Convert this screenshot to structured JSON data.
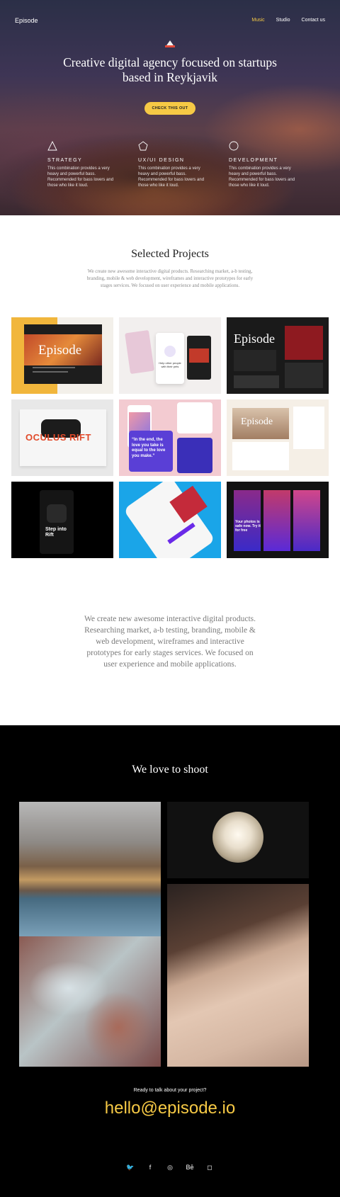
{
  "nav": {
    "logo": "Episode",
    "items": [
      {
        "label": "Music",
        "active": true
      },
      {
        "label": "Studio",
        "active": false
      },
      {
        "label": "Contact us",
        "active": false
      }
    ]
  },
  "hero": {
    "title": "Creative digital agency focused on startups based in Reykjavik",
    "cta": "CHECK THIS OUT",
    "features": [
      {
        "icon": "triangle-icon",
        "title": "STRATEGY",
        "desc": "This combination provides a very heavy and powerful bass. Recommended for bass lovers and those who like it loud."
      },
      {
        "icon": "pentagon-icon",
        "title": "UX/UI DESIGN",
        "desc": "This combination provides a very heavy and powerful bass. Recommended for bass lovers and those who like it loud."
      },
      {
        "icon": "circle-icon",
        "title": "DEVELOPMENT",
        "desc": "This combination provides a very heavy and powerful bass. Recommended for bass lovers and those who like it loud."
      }
    ]
  },
  "projects": {
    "title": "Selected Projects",
    "lead": "We create new awesome interactive digital products. Researching market, a-b testing, branding, mobile & web development, wireframes and interactive prototypes for early stages services. We focused on user experience and mobile applications.",
    "tiles": [
      {
        "name": "episode-web",
        "text": "Episode"
      },
      {
        "name": "mobile-app-white",
        "text": "Help other people with their pets"
      },
      {
        "name": "episode-dark",
        "text": "Episode"
      },
      {
        "name": "oculus-rift",
        "text": "OCULUS RIFT"
      },
      {
        "name": "quote-app",
        "text": "“In the end, the love you take is equal to the love you make.”"
      },
      {
        "name": "episode-sand",
        "text": "Episode"
      },
      {
        "name": "step-into-rift",
        "text": "Step into Rift"
      },
      {
        "name": "sneaker-app",
        "text": ""
      },
      {
        "name": "photos-app",
        "text": "Your photos is safe now. Try it for free"
      }
    ],
    "body": "We create new awesome interactive digital products. Researching market, a-b testing, branding, mobile & web development, wireframes and interactive prototypes for early stages services. We focused on user experience and mobile applications."
  },
  "shoot": {
    "title": "We love to shoot",
    "ready": "Ready to talk about your project?",
    "email": "hello@episode.io",
    "socials": [
      "twitter-icon",
      "facebook-icon",
      "dribbble-icon",
      "behance-icon",
      "instagram-icon"
    ],
    "social_glyphs": [
      "🐦",
      "f",
      "◎",
      "Bē",
      "◻"
    ]
  },
  "colors": {
    "accent": "#f6c945",
    "dark": "#000000",
    "text_muted": "#8a8a8a"
  }
}
